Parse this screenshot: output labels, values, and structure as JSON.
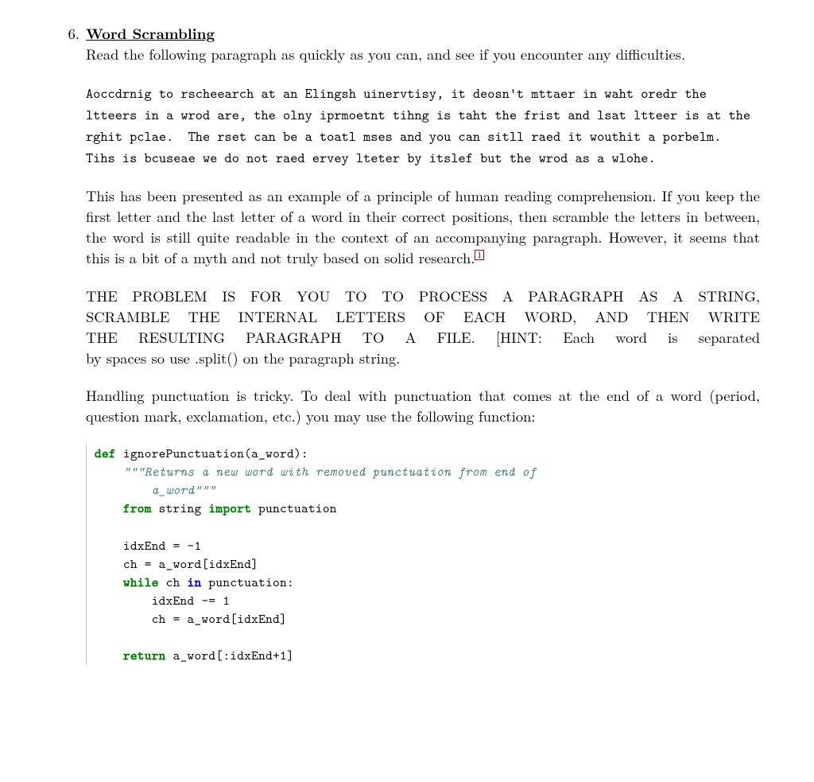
{
  "number": "6.",
  "title": "Word Scrambling",
  "intro": "Read the following paragraph as quickly as you can, and see if you encounter any difficulties.",
  "scrambled": "Aoccdrnig to rscheearch at an Elingsh uinervtisy, it deosn't mttaer in waht oredr the ltteers in a wrod are, the olny iprmoetnt tihng is taht the frist and lsat ltteer is at the rghit pclae.  The rset can be a toatl mses and you can sitll raed it wouthit a porbelm.  Tihs is bcuseae we do not raed ervey lteter by itslef but the wrod as a wlohe.",
  "explain_before_fn": "This has been presented as an example of a principle of human reading comprehension. If you keep the first letter and the last letter of a word in their correct positions, then scramble the letters in between, the word is still quite readable in the context of an accompanying paragraph. However, it seems that this is a bit of a myth and not truly based on solid research.",
  "footnote_marker": "1",
  "problem_l1": "THE PROBLEM IS FOR YOU TO TO PROCESS A PARAGRAPH AS A STRING,",
  "problem_l2": "SCRAMBLE THE INTERNAL LETTERS OF EACH WORD, AND THEN WRITE",
  "problem_l3": "THE RESULTING PARAGRAPH TO A FILE. [HINT: Each word is separated",
  "problem_l4": "by spaces so use .split() on the paragraph string.",
  "punct": "Handling punctuation is tricky. To deal with punctuation that comes at the end of a word (period, question mark, exclamation, etc.) you may use the following function:",
  "code": {
    "def": "def",
    "fname": " ignorePunctuation(a_word):",
    "doc1": "\"\"\"Returns a new word with removed punctuation from end of",
    "doc2": "    a_word\"\"\"",
    "from": "from",
    "string": " string ",
    "import": "import",
    "punctuation": " punctuation",
    "l1": "idxEnd = -1",
    "l2": "ch = a_word[idxEnd]",
    "while": "while",
    "l3a": " ch ",
    "in": "in",
    "l3b": " punctuation:",
    "l4": "    idxEnd -= 1",
    "l5": "    ch = a_word[idxEnd]",
    "return": "return",
    "retval": " a_word[:idxEnd+1]"
  }
}
